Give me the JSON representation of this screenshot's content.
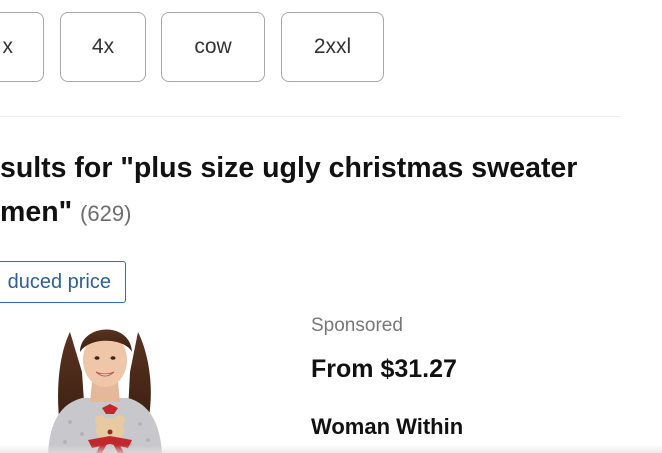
{
  "filter_chips": [
    "x",
    "4x",
    "cow",
    "2xxl"
  ],
  "results": {
    "heading_line1": "sults for \"plus size ugly christmas sweater",
    "heading_line2": "men\"",
    "count": "(629)"
  },
  "active_filter": {
    "label": "duced price"
  },
  "product": {
    "sponsored_label": "Sponsored",
    "price": "From $31.27",
    "brand": "Woman Within",
    "image_icon": "sweater-model-photo"
  },
  "colors": {
    "chip_border": "#a8a8a8",
    "filter_blue": "#2f6eb0",
    "muted_text": "#6d6d6d"
  }
}
